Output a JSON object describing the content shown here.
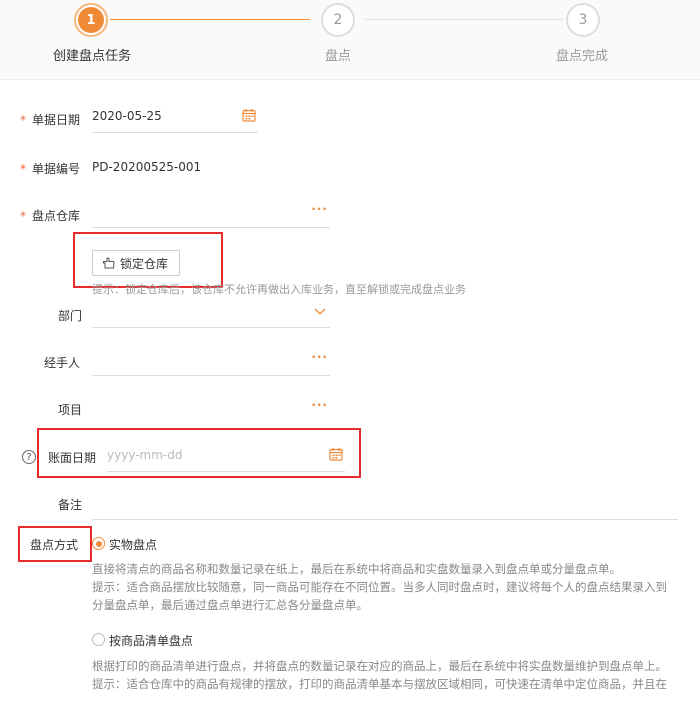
{
  "stepper": {
    "steps": [
      {
        "number": "1",
        "label": "创建盘点任务"
      },
      {
        "number": "2",
        "label": "盘点"
      },
      {
        "number": "3",
        "label": "盘点完成"
      }
    ],
    "active_color": "#f08a37"
  },
  "form": {
    "doc_date": {
      "label": "单据日期",
      "value": "2020-05-25"
    },
    "doc_number": {
      "label": "单据编号",
      "value": "PD-20200525-001"
    },
    "warehouse": {
      "label": "盘点仓库",
      "value": "",
      "dots": "···"
    },
    "lock_button": {
      "label": "锁定仓库"
    },
    "lock_hint": "提示：锁定仓库后，该仓库不允许再做出入库业务，直至解锁或完成盘点业务",
    "department": {
      "label": "部门",
      "value": ""
    },
    "handler": {
      "label": "经手人",
      "value": "",
      "dots": "···"
    },
    "project": {
      "label": "项目",
      "value": "",
      "dots": "···"
    },
    "book_date": {
      "label": "账面日期",
      "placeholder": "yyyy-mm-dd",
      "help": "?"
    },
    "remark": {
      "label": "备注",
      "value": ""
    },
    "method": {
      "label": "盘点方式",
      "options": [
        {
          "label": "实物盘点",
          "checked": true,
          "lines": [
            "直接将清点的商品名称和数量记录在纸上，最后在系统中将商品和实盘数量录入到盘点单或分量盘点单。",
            "提示：适合商品摆放比较随意，同一商品可能存在不同位置。当多人同时盘点时，建议将每个人的盘点结果录入到",
            "分量盘点单，最后通过盘点单进行汇总各分量盘点单。"
          ]
        },
        {
          "label": "按商品清单盘点",
          "checked": false,
          "lines": [
            "根据打印的商品清单进行盘点，并将盘点的数量记录在对应的商品上，最后在系统中将实盘数量维护到盘点单上。",
            "提示：适合仓库中的商品有规律的摆放，打印的商品清单基本与摆放区域相同，可快速在清单中定位商品，并且在"
          ]
        }
      ]
    },
    "required_mark": "*"
  },
  "colors": {
    "accent": "#f08a37",
    "annotation": "#e62c2c"
  }
}
